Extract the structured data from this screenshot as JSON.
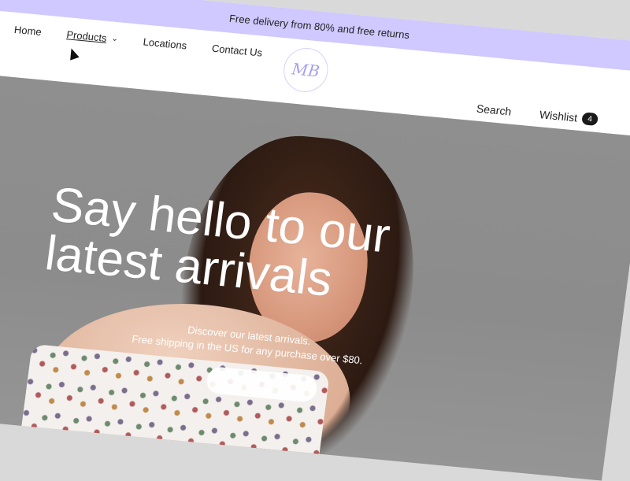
{
  "announcement": {
    "text": "Free delivery from 80% and free returns"
  },
  "nav": {
    "left": [
      {
        "label": "Home",
        "active": false,
        "has_dropdown": false
      },
      {
        "label": "Products",
        "active": true,
        "has_dropdown": true
      },
      {
        "label": "Locations",
        "active": false,
        "has_dropdown": false
      },
      {
        "label": "Contact Us",
        "active": false,
        "has_dropdown": false
      }
    ],
    "logo_text": "MB",
    "right": {
      "search_label": "Search",
      "wishlist_label": "Wishlist",
      "wishlist_count": "4"
    }
  },
  "hero": {
    "headline": "Say hello to our latest arrivals",
    "subtext_line1": "Discover our latest arrivals.",
    "subtext_line2": "Free shipping in the US for any purchase over $80."
  },
  "colors": {
    "announcement_bg": "#cfc9ff",
    "logo_accent": "#a89ff0",
    "badge_bg": "#1a1a1a"
  }
}
